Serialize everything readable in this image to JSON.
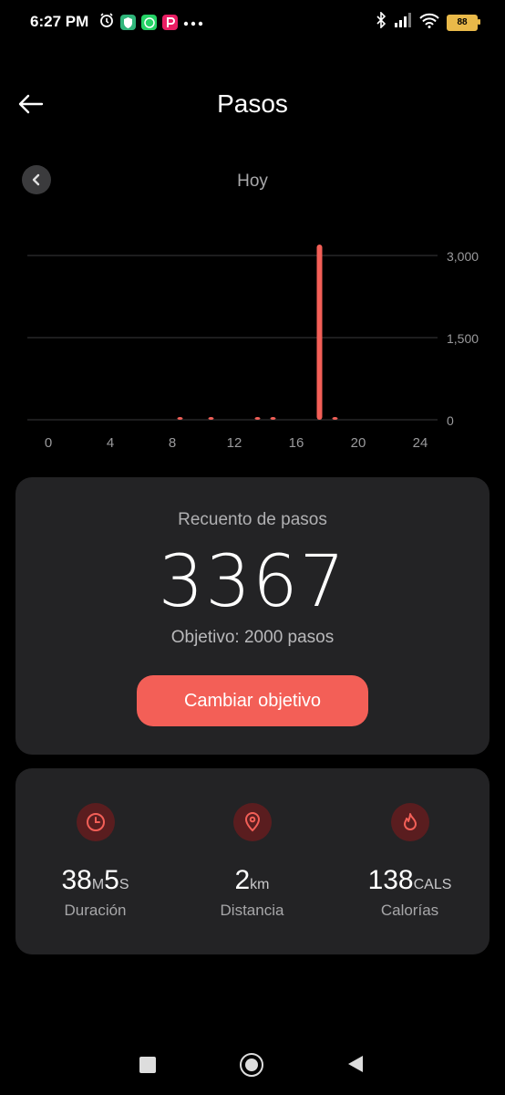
{
  "status_bar": {
    "time": "6:27 PM",
    "battery": "88",
    "icons": [
      "alarm-icon",
      "vpn-shield-icon",
      "whatsapp-icon",
      "app-p-icon",
      "more-dots-icon",
      "bluetooth-icon",
      "signal-icon",
      "wifi-icon",
      "battery-icon"
    ]
  },
  "header": {
    "title": "Pasos"
  },
  "day_nav": {
    "label": "Hoy"
  },
  "chart_data": {
    "type": "bar",
    "xlabel": "",
    "ylabel": "",
    "x_ticks": [
      "0",
      "4",
      "8",
      "12",
      "16",
      "20",
      "24"
    ],
    "y_ticks": [
      "0",
      "1,500",
      "3,000"
    ],
    "ylim": [
      0,
      3000
    ],
    "xlim": [
      0,
      24
    ],
    "grid": true,
    "color": "#f35f57",
    "x": [
      8,
      10,
      13,
      14,
      17,
      18
    ],
    "values": [
      15,
      12,
      10,
      40,
      3200,
      45
    ]
  },
  "steps": {
    "label": "Recuento de pasos",
    "count": "3367",
    "goal": "Objetivo: 2000 pasos",
    "button": "Cambiar objetivo"
  },
  "stats": {
    "duration": {
      "min": "38",
      "min_unit": "M",
      "sec": "5",
      "sec_unit": "S",
      "label": "Duración"
    },
    "distance": {
      "value": "2",
      "unit": "km",
      "label": "Distancia"
    },
    "calories": {
      "value": "138",
      "unit": "CALS",
      "label": "Calorías"
    }
  },
  "colors": {
    "accent": "#f35f57",
    "card": "#232325",
    "icon_bg": "#5a1d1f"
  }
}
